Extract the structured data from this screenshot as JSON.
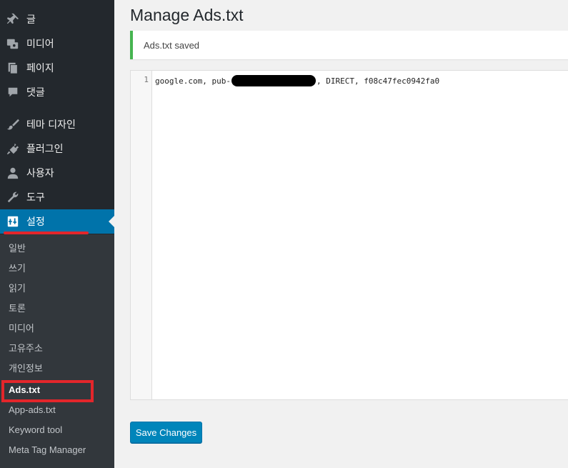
{
  "sidebar": {
    "menu": [
      {
        "label": "글",
        "icon": "pin-icon"
      },
      {
        "label": "미디어",
        "icon": "media-icon"
      },
      {
        "label": "페이지",
        "icon": "page-icon"
      },
      {
        "label": "댓글",
        "icon": "comment-icon"
      },
      {
        "label": "테마 디자인",
        "icon": "brush-icon"
      },
      {
        "label": "플러그인",
        "icon": "plugin-icon"
      },
      {
        "label": "사용자",
        "icon": "user-icon"
      },
      {
        "label": "도구",
        "icon": "wrench-icon"
      },
      {
        "label": "설정",
        "icon": "settings-icon",
        "active": true
      }
    ],
    "submenu": [
      {
        "label": "일반"
      },
      {
        "label": "쓰기"
      },
      {
        "label": "읽기"
      },
      {
        "label": "토론"
      },
      {
        "label": "미디어"
      },
      {
        "label": "고유주소"
      },
      {
        "label": "개인정보"
      },
      {
        "label": "Ads.txt",
        "current": true
      },
      {
        "label": "App-ads.txt"
      },
      {
        "label": "Keyword tool"
      },
      {
        "label": "Meta Tag Manager"
      }
    ]
  },
  "main": {
    "title": "Manage Ads.txt",
    "notice": "Ads.txt saved",
    "editor": {
      "line_number": "1",
      "code_prefix": "google.com, pub-",
      "code_suffix": ", DIRECT, f08c47fec0942fa0"
    },
    "save_label": "Save Changes"
  },
  "colors": {
    "sidebar_bg": "#23282d",
    "submenu_bg": "#32373c",
    "active_bg": "#0073aa",
    "notice_border": "#46b450",
    "button_bg": "#0085ba",
    "highlight_red": "#e3262b"
  }
}
